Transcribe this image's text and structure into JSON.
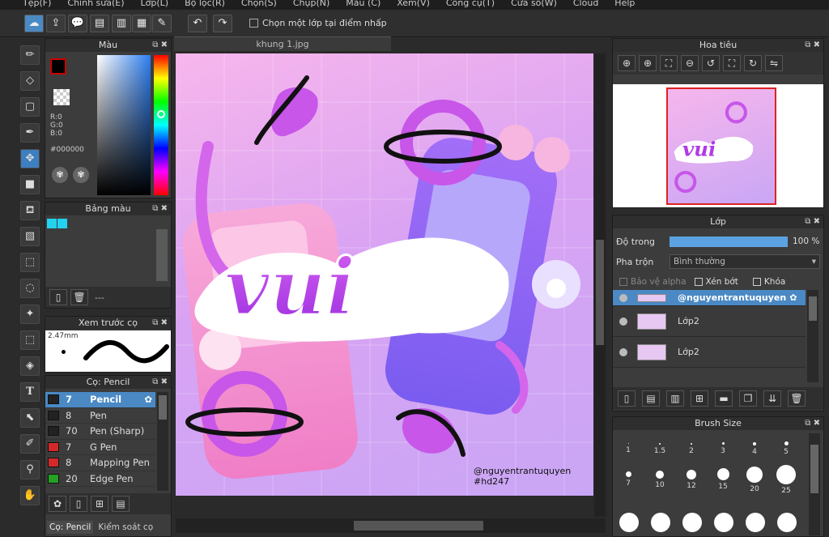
{
  "menu": [
    "Tệp(F)",
    "Chỉnh sửa(E)",
    "Lớp(L)",
    "Bộ lọc(R)",
    "Chọn(S)",
    "Chụp(N)",
    "Màu (C)",
    "Xem(V)",
    "Công cụ(T)",
    "Cửa sổ(W)",
    "Cloud",
    "Help"
  ],
  "toolbar": {
    "checkbox_label": "Chọn một lớp tại điểm nhấp"
  },
  "color_panel": {
    "title": "Màu",
    "r": "R:0",
    "g": "G:0",
    "b": "B:0",
    "hex": "#000000"
  },
  "palette_panel": {
    "title": "Bảng màu",
    "name": "---"
  },
  "brush_preview": {
    "title": "Xem trước cọ",
    "size": "2.47mm"
  },
  "brush_panel": {
    "title": "Cọ: Pencil",
    "items": [
      {
        "size": "7",
        "name": "Pencil",
        "color": "#222222"
      },
      {
        "size": "8",
        "name": "Pen",
        "color": "#222222"
      },
      {
        "size": "70",
        "name": "Pen (Sharp)",
        "color": "#222222"
      },
      {
        "size": "7",
        "name": "G Pen",
        "color": "#d22a2a"
      },
      {
        "size": "8",
        "name": "Mapping Pen",
        "color": "#d22a2a"
      },
      {
        "size": "20",
        "name": "Edge Pen",
        "color": "#24a024"
      }
    ],
    "tab1": "Cọ: Pencil",
    "tab2": "Kiểm soát cọ"
  },
  "canvas": {
    "tab": "khung 1.jpg",
    "word": "vui",
    "credit_line1": "@nguyentrantuquyen",
    "credit_line2": "#hd247"
  },
  "navigator": {
    "title": "Hoa tiêu"
  },
  "layers": {
    "title": "Lớp",
    "opacity_label": "Độ trong",
    "opacity_value": "100 %",
    "opacity": 1.0,
    "blend_label": "Pha trộn",
    "blend_value": "Bình thường",
    "protect_alpha": "Bảo vệ alpha",
    "clipping": "Xén bớt",
    "lock": "Khóa",
    "items": [
      {
        "name": "@nguyentrantuquyen"
      },
      {
        "name": "Lớp2"
      },
      {
        "name": "Lớp2"
      }
    ]
  },
  "brush_size": {
    "title": "Brush Size",
    "sizes": [
      "1",
      "1.5",
      "2",
      "3",
      "4",
      "5",
      "7",
      "10",
      "12",
      "15",
      "20",
      "25"
    ]
  }
}
